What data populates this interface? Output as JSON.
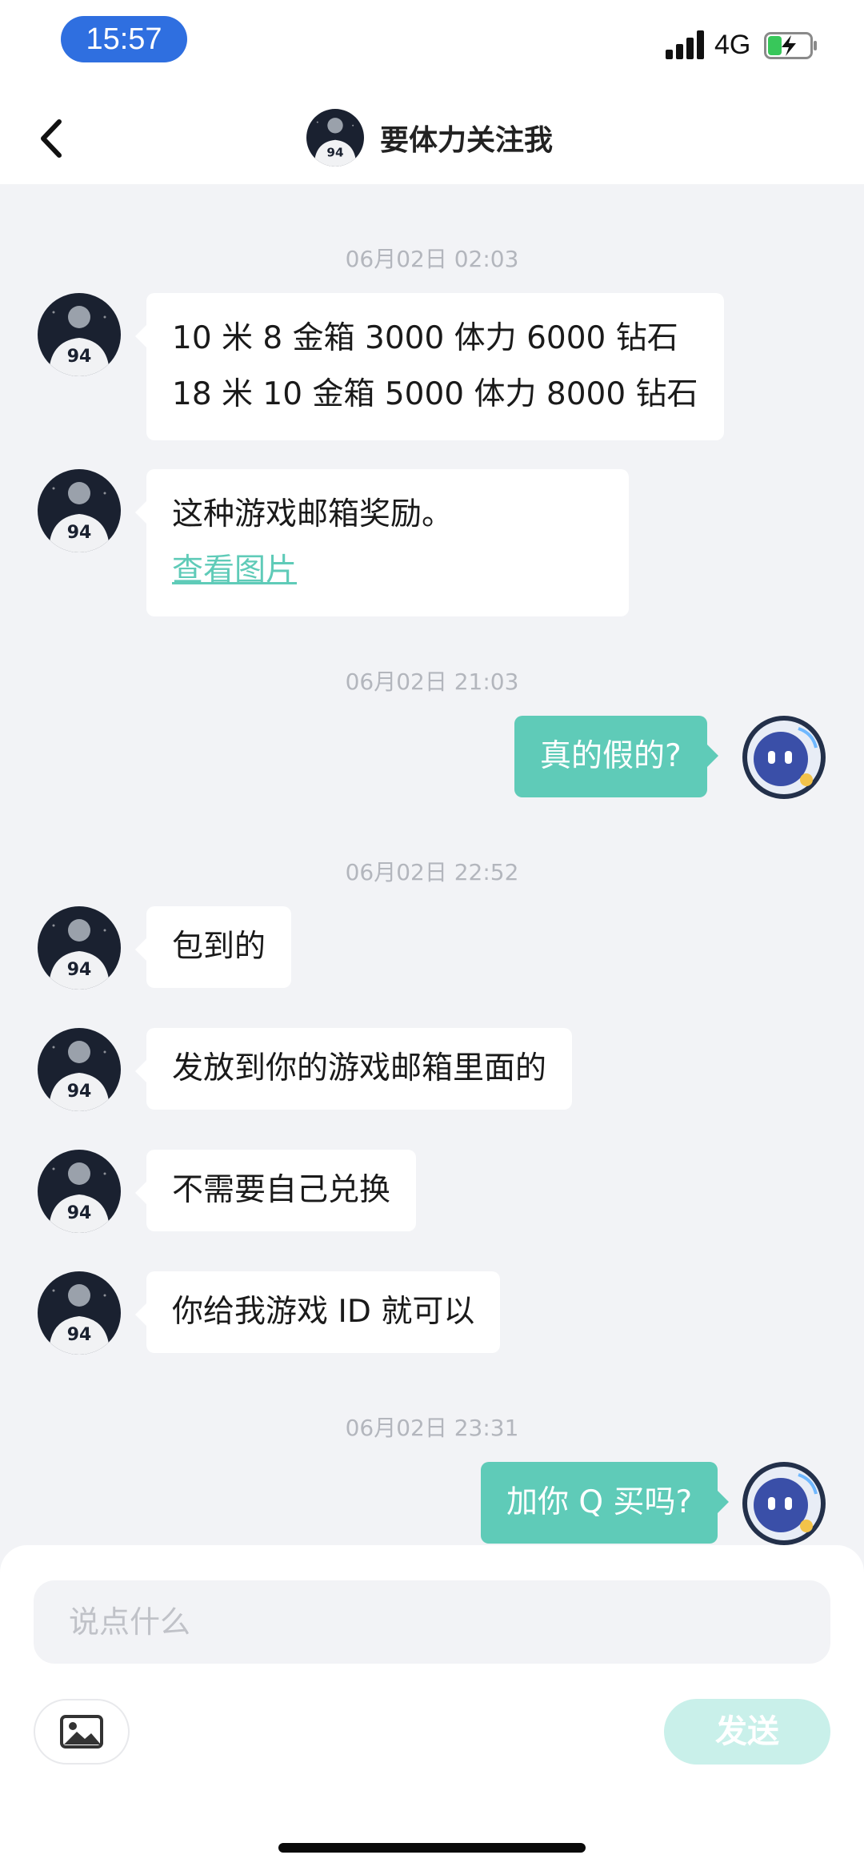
{
  "status_bar": {
    "time": "15:57",
    "network": "4G",
    "battery_color": "#38c75a"
  },
  "nav": {
    "title": "要体力关注我",
    "back_icon": "chevron-left-icon"
  },
  "colors": {
    "accent": "#5fcbb8",
    "background": "#f2f3f6",
    "timestamp": "#b3b6bd",
    "time_pill": "#2f6fe0"
  },
  "messages": {
    "ts1": "06月02日 02:03",
    "m1": {
      "line1": "10 米 8 金箱 3000 体力 6000 钻石",
      "line2": "18 米 10 金箱 5000 体力 8000 钻石"
    },
    "m2": {
      "text": "这种游戏邮箱奖励。",
      "link": "查看图片"
    },
    "ts2": "06月02日 21:03",
    "m3": "真的假的?",
    "ts3": "06月02日 22:52",
    "m4": "包到的",
    "m5": "发放到你的游戏邮箱里面的",
    "m6": "不需要自己兑换",
    "m7": "你给我游戏 ID 就可以",
    "ts4": "06月02日 23:31",
    "m8": "加你 Q 买吗?"
  },
  "composer": {
    "placeholder": "说点什么",
    "send_label": "发送",
    "image_icon": "image-icon"
  }
}
